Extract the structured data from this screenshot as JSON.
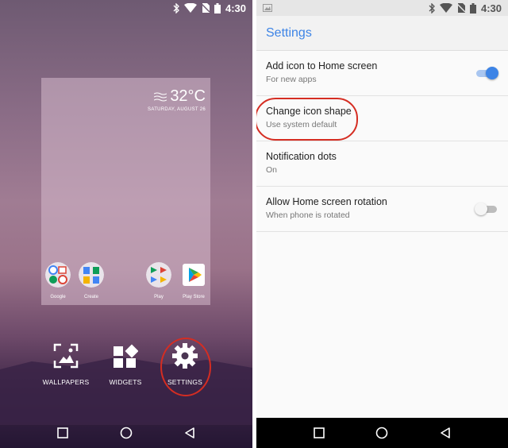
{
  "status_bar": {
    "time": "4:30"
  },
  "home": {
    "weather": {
      "temperature": "32°C",
      "date": "SATURDAY, AUGUST 26"
    },
    "apps": [
      {
        "label": "Google",
        "icon": "google-folder-icon"
      },
      {
        "label": "Create",
        "icon": "create-folder-icon"
      },
      {
        "label": "Play",
        "icon": "play-folder-icon"
      },
      {
        "label": "Play Store",
        "icon": "play-store-icon"
      }
    ],
    "shortcuts": [
      {
        "label": "WALLPAPERS",
        "icon": "wallpaper-icon"
      },
      {
        "label": "WIDGETS",
        "icon": "widgets-icon"
      },
      {
        "label": "SETTINGS",
        "icon": "gear-icon"
      }
    ]
  },
  "settings": {
    "title": "Settings",
    "items": [
      {
        "title": "Add icon to Home screen",
        "subtitle": "For new apps",
        "toggle": true
      },
      {
        "title": "Change icon shape",
        "subtitle": "Use system default"
      },
      {
        "title": "Notification dots",
        "subtitle": "On"
      },
      {
        "title": "Allow Home screen rotation",
        "subtitle": "When phone is rotated",
        "toggle": false
      }
    ]
  },
  "colors": {
    "accent": "#3d84e6",
    "highlight_ring": "#d52d22",
    "nav_bar": "#000000"
  }
}
